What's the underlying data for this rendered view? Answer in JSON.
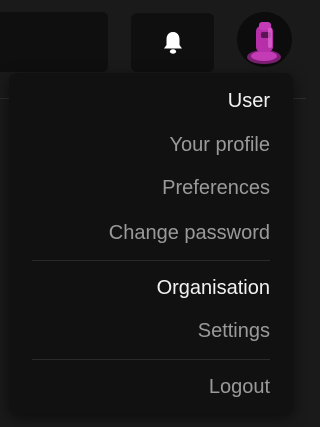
{
  "header": {
    "notifications_icon": "bell-icon",
    "avatar_icon": "robot-avatar"
  },
  "user_menu": {
    "sections": [
      {
        "heading": "User",
        "items": [
          "Your profile",
          "Preferences",
          "Change password"
        ]
      },
      {
        "heading": "Organisation",
        "items": [
          "Settings"
        ]
      }
    ],
    "logout_label": "Logout"
  },
  "colors": {
    "background": "#1a1a1a",
    "menu_background": "#111111",
    "heading_text": "#f2f2f2",
    "item_text": "#9a9a9a",
    "avatar_accent": "#b62fa8"
  }
}
